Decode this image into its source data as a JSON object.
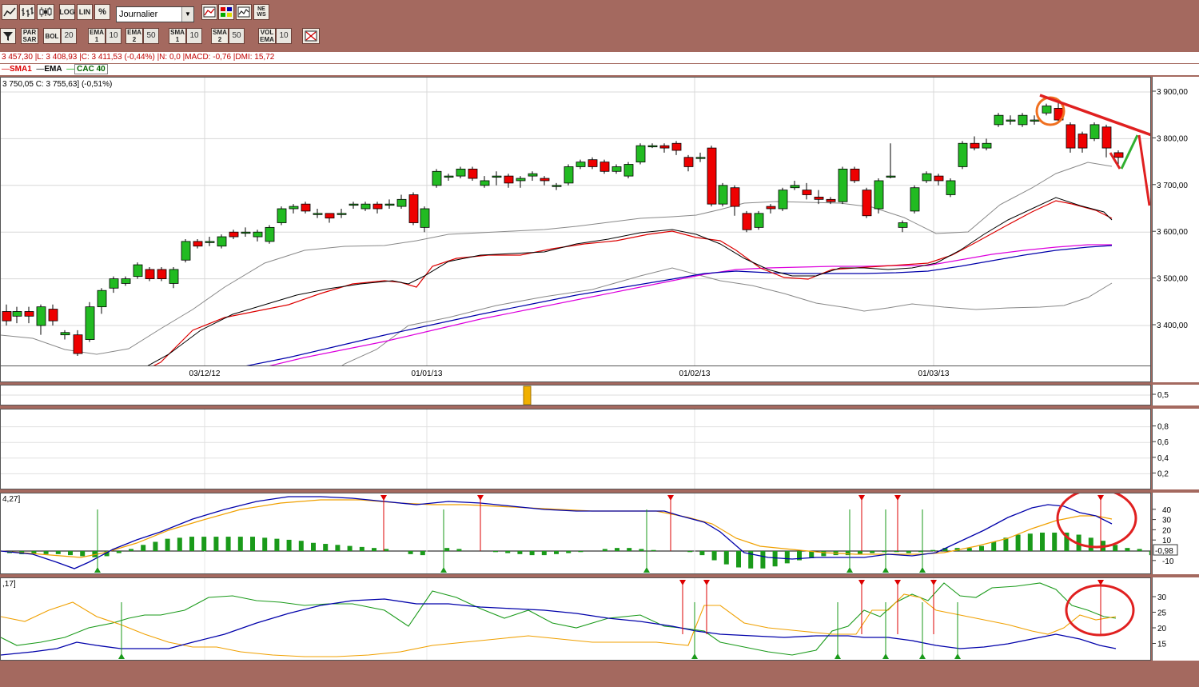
{
  "toolbar_top": {
    "chart_type_buttons": [
      "line-chart-icon",
      "ohlc-chart-icon",
      "candlestick-chart-icon"
    ],
    "scale_buttons": [
      "LOG",
      "LIN",
      "%"
    ],
    "period_select": "Journalier",
    "tool_icons": [
      "compare-icon",
      "palette-icon",
      "indicator-icon",
      "news-icon"
    ]
  },
  "toolbar_indicators": [
    {
      "label": "PAR SAR",
      "value": ""
    },
    {
      "label": "BOL",
      "value": "20"
    },
    {
      "label": "EMA 1",
      "value": "10"
    },
    {
      "label": "EMA 2",
      "value": "50"
    },
    {
      "label": "SMA 1",
      "value": "10"
    },
    {
      "label": "SMA 2",
      "value": "50"
    },
    {
      "label": "VOL EMA",
      "value": "10"
    }
  ],
  "info_line": "3 457,30 |L: 3 408,93 |C: 3 411,53 (-0,44%) |N: 0,0 |MACD: -0,76 |DMI: 15,72",
  "legend": {
    "sma1": "SMA1",
    "ema": "EMA",
    "cac": "CAC 40"
  },
  "price_line": "3 750,05  C: 3 755,63] (-0,51%)",
  "axis_price": [
    "3 900,00",
    "3 800,00",
    "3 700,00",
    "3 600,00",
    "3 500,00",
    "3 400,00"
  ],
  "axis_dates": [
    "03/12/12",
    "01/01/13",
    "01/02/13",
    "01/03/13"
  ],
  "panel2_axis": [
    "0,5"
  ],
  "panel3_axis": [
    "0,8",
    "0,6",
    "0,4",
    "0,2"
  ],
  "panel4_label": "4,27]",
  "panel4_axis": [
    "40",
    "30",
    "20",
    "10",
    "-10"
  ],
  "panel4_value": "-0,98",
  "panel5_label": ",17]",
  "panel5_axis": [
    "30",
    "25",
    "20",
    "15"
  ],
  "colors": {
    "bull": "#22bb22",
    "bear": "#ee0000",
    "ema": "#000000",
    "sma": "#dd0000",
    "blue": "#0000aa",
    "magenta": "#dd00dd",
    "gray": "#888888",
    "orange": "#f0a000"
  }
}
